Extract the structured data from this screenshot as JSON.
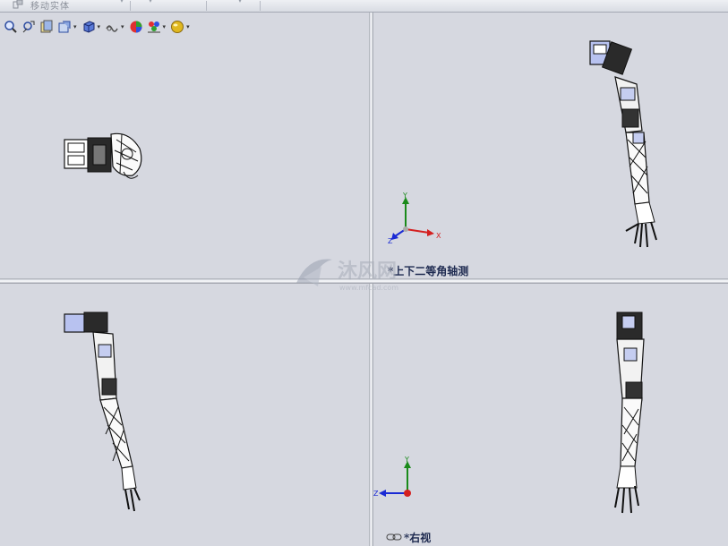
{
  "toolbar": {
    "move_body_label": "移动实体"
  },
  "views": {
    "top_right": {
      "label": "*上下二等角轴测"
    },
    "bottom_right": {
      "label": "*右视"
    }
  },
  "axes": {
    "x": "X",
    "y": "Y",
    "z": "Z"
  },
  "watermark": {
    "text": "沐风网",
    "url": "www.mfcad.com"
  },
  "icons": [
    "zoom-to-fit-icon",
    "zoom-area-icon",
    "previous-view-icon",
    "section-view-icon",
    "view-orientation-icon",
    "display-style-icon",
    "hide-show-items-icon",
    "edit-appearance-icon",
    "apply-scene-icon",
    "view-settings-icon"
  ],
  "colors": {
    "viewport_bg": "#d6d8e0",
    "axis_x": "#d42020",
    "axis_y": "#1a8a1a",
    "axis_z": "#1a2ad4",
    "label_text": "#1e2a50"
  }
}
